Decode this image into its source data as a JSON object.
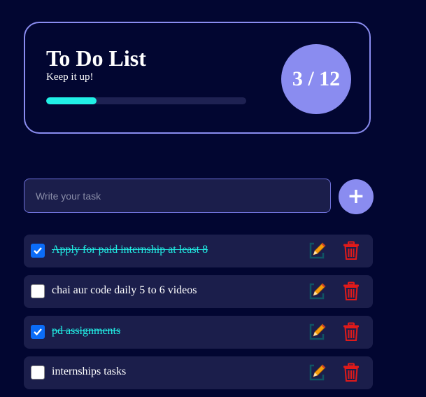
{
  "header": {
    "title": "To Do List",
    "subtitle": "Keep it up!",
    "progress_fraction": 0.25,
    "counter": "3 / 12"
  },
  "input": {
    "placeholder": "Write your task",
    "value": ""
  },
  "add_button": {
    "label": "+"
  },
  "tasks": [
    {
      "text": "Apply for paid internship at least 8",
      "completed": true
    },
    {
      "text": "chai aur code daily 5 to 6 videos",
      "completed": false
    },
    {
      "text": "pd assignments",
      "completed": true
    },
    {
      "text": "internships tasks",
      "completed": false
    }
  ],
  "icons": {
    "edit": "edit-pencil-icon",
    "delete": "trash-icon"
  },
  "colors": {
    "background": "#020631",
    "accent": "#8a8cf0",
    "progress": "#21f0e6",
    "completed_text": "#21f0e6",
    "checkbox_checked": "#0b6cf8",
    "delete": "#e01a1a",
    "pencil": "#f59e0b",
    "item_background": "#1b1e4b"
  }
}
